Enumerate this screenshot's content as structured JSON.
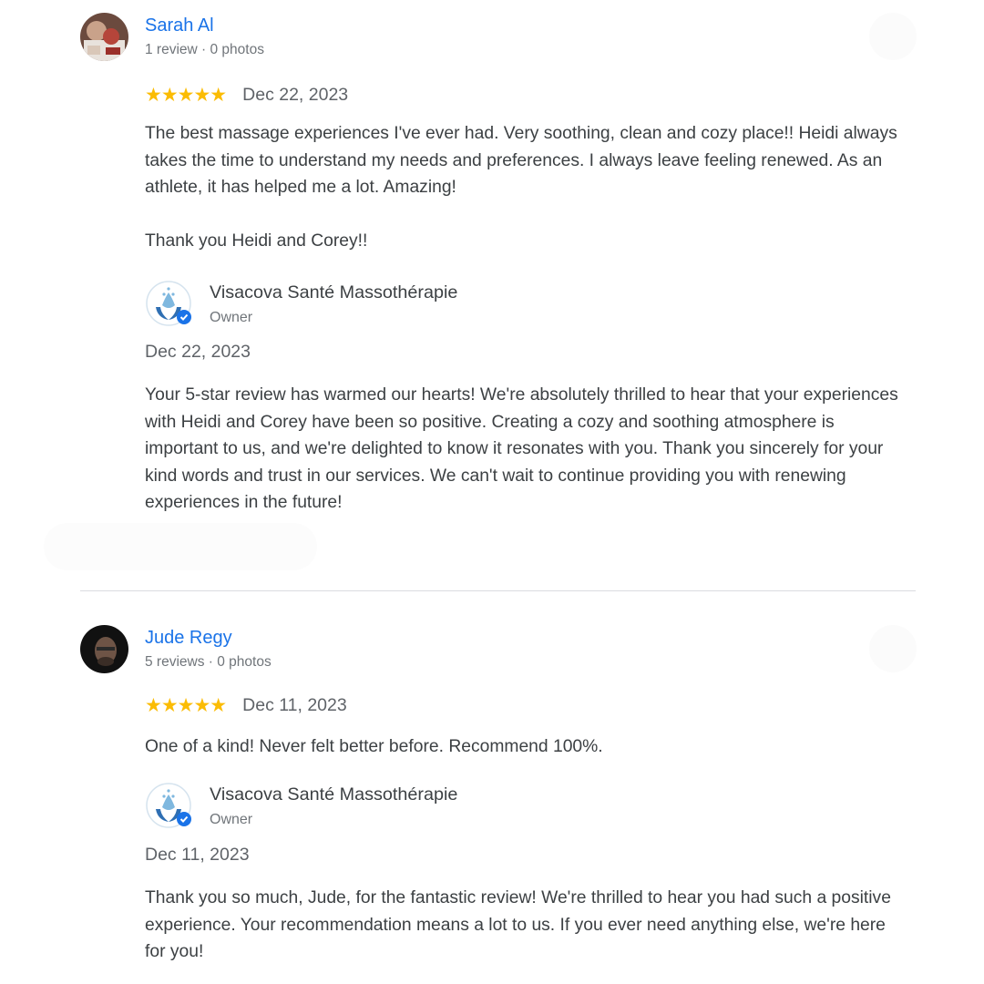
{
  "reviews": [
    {
      "reviewer_name": "Sarah Al",
      "reviewer_meta": "1 review · 0 photos",
      "rating": 5,
      "stars": "★★★★★",
      "date": "Dec 22, 2023",
      "text_p1": "The best massage experiences I've ever had. Very soothing, clean and cozy place!! Heidi always takes the time to understand my needs and preferences. I always leave feeling renewed. As an athlete, it has helped me a lot. Amazing!",
      "text_p2": "Thank you Heidi and Corey!!",
      "owner_name": "Visacova Santé Massothérapie",
      "owner_role": "Owner",
      "reply_date": "Dec 22, 2023",
      "reply_text": "Your 5-star review has warmed our hearts! We're absolutely thrilled to hear that your experiences with Heidi and Corey have been so positive. Creating a cozy and soothing atmosphere is important to us, and we're delighted to know it resonates with you. Thank you sincerely for your kind words and trust in our services. We can't wait to continue providing you with renewing experiences in the future!"
    },
    {
      "reviewer_name": "Jude Regy",
      "reviewer_meta": "5 reviews · 0 photos",
      "rating": 5,
      "stars": "★★★★★",
      "date": "Dec 11, 2023",
      "text_p1": "One of a kind! Never felt better before. Recommend 100%.",
      "owner_name": "Visacova Santé Massothérapie",
      "owner_role": "Owner",
      "reply_date": "Dec 11, 2023",
      "reply_text": "Thank you so much, Jude, for the fantastic review! We're thrilled to hear you had such a positive experience. Your recommendation means a lot to us. If you ever need anything else, we're here for you!"
    }
  ],
  "colors": {
    "name_link": "#1a73e8",
    "star": "#fbbc04",
    "text": "#3c4043",
    "muted": "#70757a",
    "divider": "#dadce0"
  },
  "icons": {
    "reviewer_1_avatar": "avatar-photo",
    "reviewer_2_avatar": "avatar-photo",
    "owner_logo": "hands-lotus-logo",
    "verified": "verified-check-icon",
    "more": "more-options-icon"
  }
}
